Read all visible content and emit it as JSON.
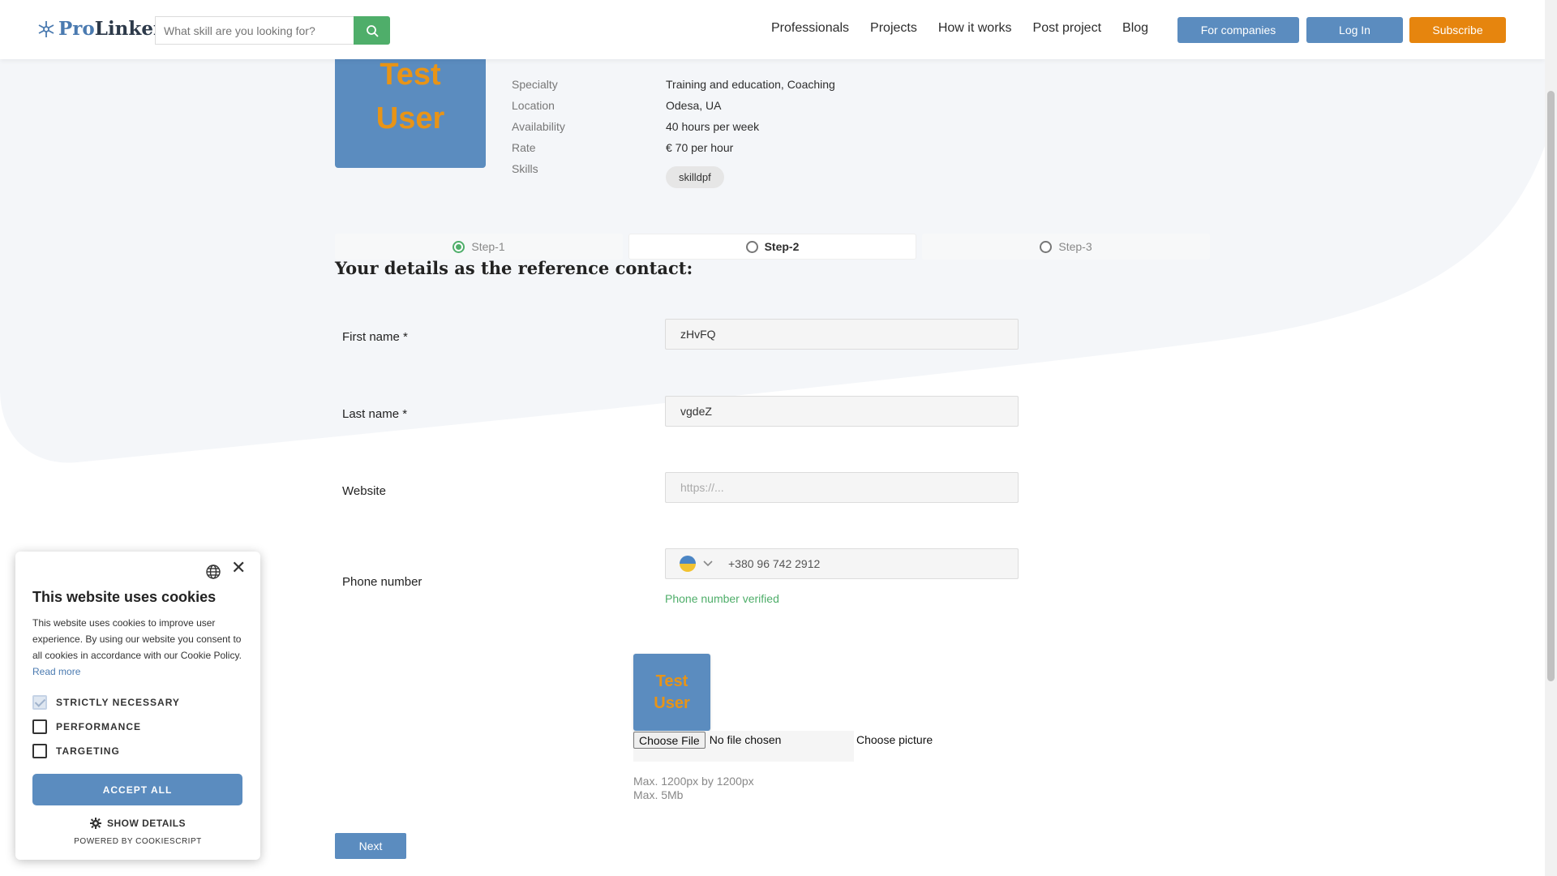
{
  "header": {
    "logo_text_pro": "Pro",
    "logo_text_linker": "Linker",
    "search_placeholder": "What skill are you looking for?",
    "nav": [
      "Professionals",
      "Projects",
      "How it works",
      "Post project",
      "Blog"
    ],
    "btn_companies": "For companies",
    "btn_login": "Log In",
    "btn_subscribe": "Subscribe"
  },
  "profile": {
    "avatar_line1": "Test",
    "avatar_line2": "User",
    "rows": [
      {
        "label": "Specialty",
        "value": "Training and education, Coaching"
      },
      {
        "label": "Location",
        "value": "Odesa, UA"
      },
      {
        "label": "Availability",
        "value": "40 hours per week"
      },
      {
        "label": "Rate",
        "value": "€ 70 per hour"
      },
      {
        "label": "Skills",
        "value": ""
      }
    ],
    "skill_tag": "skilldpf"
  },
  "steps": [
    {
      "label": "Step-1",
      "state": "done"
    },
    {
      "label": "Step-2",
      "state": "active"
    },
    {
      "label": "Step-3",
      "state": "pending"
    }
  ],
  "form": {
    "title": "Your details as the reference contact:",
    "first_name_label": "First name *",
    "first_name_value": "zHvFQ",
    "last_name_label": "Last name *",
    "last_name_value": "vgdeZ",
    "website_label": "Website",
    "website_placeholder": "https://...",
    "phone_label": "Phone number",
    "phone_value": "+380 96 742 2912",
    "phone_verified": "Phone number verified",
    "picture_avatar_line1": "Test",
    "picture_avatar_line2": "User",
    "file_button": "Choose File",
    "file_status": "No file chosen",
    "choose_picture": "Choose picture",
    "hint_size": "Max. 1200px by 1200px",
    "hint_weight": "Max. 5Mb",
    "next_button": "Next"
  },
  "cookie": {
    "title": "This website uses cookies",
    "text": "This website uses cookies to improve user experience. By using our website you consent to all cookies in accordance with our Cookie Policy.",
    "read_more": "Read more",
    "options": [
      {
        "label": "STRICTLY NECESSARY",
        "checked": true
      },
      {
        "label": "PERFORMANCE",
        "checked": false
      },
      {
        "label": "TARGETING",
        "checked": false
      }
    ],
    "accept_all": "ACCEPT ALL",
    "show_details": "SHOW DETAILS",
    "powered_by": "POWERED BY COOKIESCRIPT"
  },
  "colors": {
    "accent_blue": "#5b8cbf",
    "accent_orange": "#e6850e",
    "success_green": "#4fae6a"
  }
}
